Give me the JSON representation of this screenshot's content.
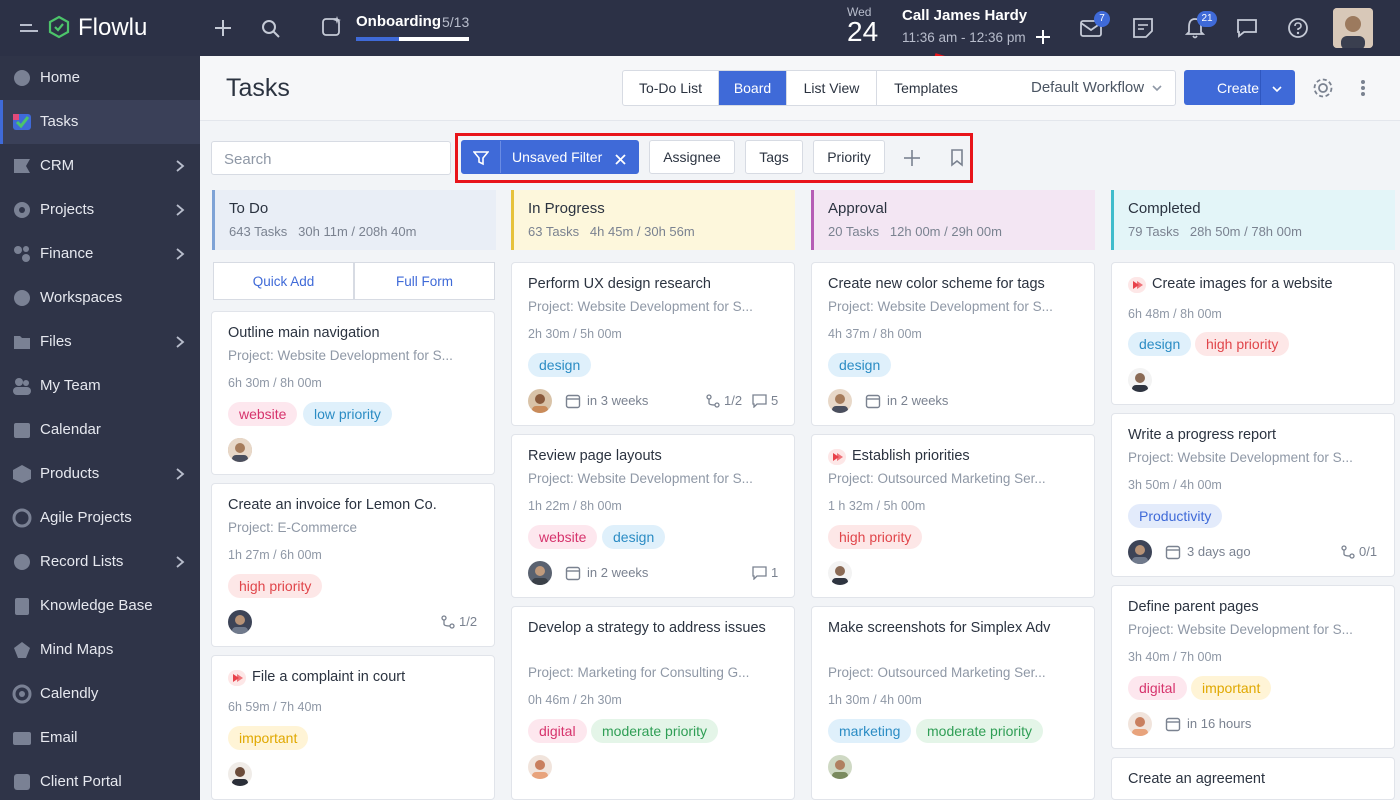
{
  "brand": {
    "name": "Flowlu"
  },
  "topbar": {
    "onboarding_label": "Onboarding",
    "onboarding_count": "5/13",
    "onboarding_progress": 0.38,
    "date_day": "Wed",
    "date_num": "24",
    "event_title": "Call James Hardy",
    "event_time": "11:36 am - 12:36 pm",
    "mail_badge": "7",
    "notif_badge": "21"
  },
  "sidebar": {
    "items": [
      {
        "label": "Home"
      },
      {
        "label": "Tasks"
      },
      {
        "label": "CRM"
      },
      {
        "label": "Projects"
      },
      {
        "label": "Finance"
      },
      {
        "label": "Workspaces"
      },
      {
        "label": "Files"
      },
      {
        "label": "My Team"
      },
      {
        "label": "Calendar"
      },
      {
        "label": "Products"
      },
      {
        "label": "Agile Projects"
      },
      {
        "label": "Record Lists"
      },
      {
        "label": "Knowledge Base"
      },
      {
        "label": "Mind Maps"
      },
      {
        "label": "Calendly"
      },
      {
        "label": "Email"
      },
      {
        "label": "Client Portal"
      }
    ]
  },
  "header": {
    "title": "Tasks",
    "views": [
      "To-Do List",
      "Board",
      "List View",
      "Templates"
    ],
    "workflow": "Default Workflow",
    "create_label": "Create"
  },
  "filters": {
    "search_placeholder": "Search",
    "unsaved_filter": "Unsaved Filter",
    "assignee": "Assignee",
    "tags": "Tags",
    "priority": "Priority"
  },
  "columns": [
    {
      "title": "To Do",
      "tasks": "643 Tasks",
      "time": "30h 11m / 208h 40m"
    },
    {
      "title": "In Progress",
      "tasks": "63 Tasks",
      "time": "4h 45m / 30h 56m"
    },
    {
      "title": "Approval",
      "tasks": "20 Tasks",
      "time": "12h 00m / 29h 00m"
    },
    {
      "title": "Completed",
      "tasks": "79 Tasks",
      "time": "28h 50m / 78h 00m"
    }
  ],
  "quick": {
    "quick_add": "Quick Add",
    "full_form": "Full Form"
  },
  "cards": {
    "todo": [
      {
        "title": "Outline main navigation",
        "project": "Project: Website Development for S...",
        "time": "6h 30m / 8h 00m",
        "tags": [
          "website",
          "low priority"
        ]
      },
      {
        "title": "Create an invoice for Lemon Co.",
        "project": "Project: E-Commerce",
        "time": "1h 27m / 6h 00m",
        "tags": [
          "high priority"
        ],
        "subtasks": "1/2"
      },
      {
        "title": "File a complaint in court",
        "time": "6h 59m / 7h 40m",
        "tags": [
          "important"
        ]
      }
    ],
    "progress": [
      {
        "title": "Perform UX design research",
        "project": "Project: Website Development for S...",
        "time": "2h 30m / 5h 00m",
        "tags": [
          "design"
        ],
        "due": "in 3 weeks",
        "subtasks": "1/2",
        "comments": "5"
      },
      {
        "title": "Review page layouts",
        "project": "Project: Website Development for S...",
        "time": "1h 22m / 8h 00m",
        "tags": [
          "website",
          "design"
        ],
        "due": "in 2 weeks",
        "comments": "1"
      },
      {
        "title": "Develop a strategy to address issues",
        "project": "Project: Marketing for Consulting G...",
        "time": "0h 46m / 2h 30m",
        "tags": [
          "digital",
          "moderate priority"
        ]
      }
    ],
    "approval": [
      {
        "title": "Create new color scheme for tags",
        "project": "Project: Website Development for S...",
        "time": "4h 37m / 8h 00m",
        "tags": [
          "design"
        ],
        "due": "in 2 weeks"
      },
      {
        "title": "Establish priorities",
        "project": "Project: Outsourced Marketing Ser...",
        "time": "1 h 32m / 5h 00m",
        "tags": [
          "high priority"
        ]
      },
      {
        "title": "Make screenshots for Simplex Adv",
        "project": "Project: Outsourced Marketing Ser...",
        "time": "1h 30m / 4h 00m",
        "tags": [
          "marketing",
          "moderate priority"
        ]
      }
    ],
    "completed": [
      {
        "title": "Create images for a website",
        "time": "6h 48m / 8h 00m",
        "tags": [
          "design",
          "high priority"
        ]
      },
      {
        "title": "Write a progress report",
        "project": "Project: Website Development for S...",
        "time": "3h 50m  / 4h 00m",
        "tags": [
          "Productivity"
        ],
        "due": "3 days ago",
        "subtasks": "0/1"
      },
      {
        "title": "Define parent pages",
        "project": "Project: Website Development for S...",
        "time": "3h 40m / 7h 00m",
        "tags": [
          "digital",
          "important"
        ],
        "due": "in 16 hours"
      },
      {
        "title": "Create an agreement"
      }
    ]
  },
  "colors": {
    "accent": "#3f6ad8",
    "topbar": "#2c3146",
    "sidebar": "#2f3448",
    "highlight": "#e8141a"
  }
}
